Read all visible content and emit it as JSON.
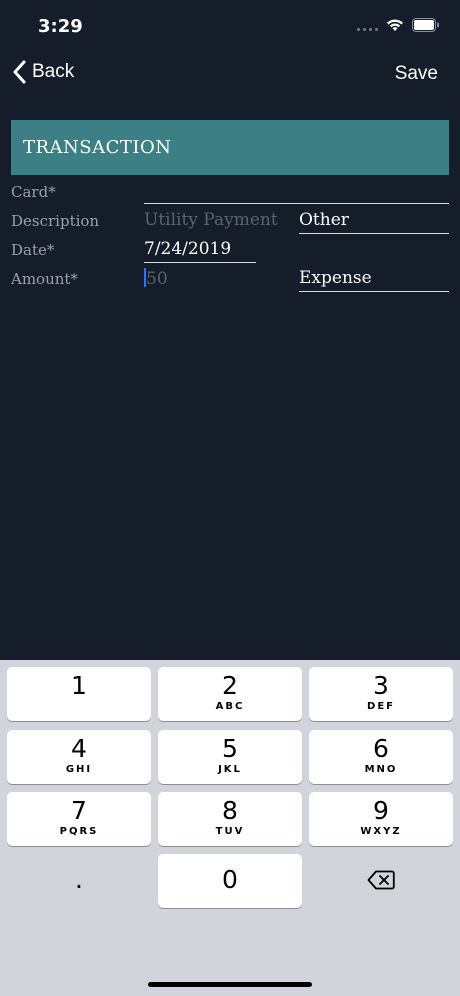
{
  "status": {
    "time": "3:29"
  },
  "nav": {
    "back_label": "Back",
    "save_label": "Save"
  },
  "section": {
    "title": "TRANSACTION"
  },
  "form": {
    "card_label": "Card*",
    "description_label": "Description",
    "description_placeholder": "Utility Payment",
    "category_value": "Other",
    "date_label": "Date*",
    "date_value": "7/24/2019",
    "amount_label": "Amount*",
    "amount_placeholder": "50",
    "type_value": "Expense"
  },
  "keyboard": {
    "keys": [
      {
        "digit": "1",
        "letters": ""
      },
      {
        "digit": "2",
        "letters": "ABC"
      },
      {
        "digit": "3",
        "letters": "DEF"
      },
      {
        "digit": "4",
        "letters": "GHI"
      },
      {
        "digit": "5",
        "letters": "JKL"
      },
      {
        "digit": "6",
        "letters": "MNO"
      },
      {
        "digit": "7",
        "letters": "PQRS"
      },
      {
        "digit": "8",
        "letters": "TUV"
      },
      {
        "digit": "9",
        "letters": "WXYZ"
      }
    ],
    "decimal": ".",
    "zero": "0"
  },
  "colors": {
    "background": "#151d2a",
    "header": "#3c8086",
    "keyboard": "#d1d4db",
    "cursor": "#3b6cff"
  }
}
